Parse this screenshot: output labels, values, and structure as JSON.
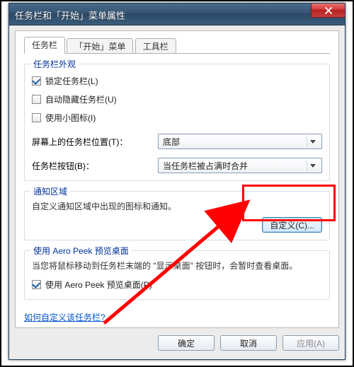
{
  "window": {
    "title": "任务栏和「开始」菜单属性"
  },
  "tabs": {
    "t0": "任务栏",
    "t1": "「开始」菜单",
    "t2": "工具栏"
  },
  "appearance": {
    "legend": "任务栏外观",
    "lock": "锁定任务栏(L)",
    "autohide": "自动隐藏任务栏(U)",
    "smallicons": "使用小图标(I)"
  },
  "position": {
    "label": "屏幕上的任务栏位置(T)：",
    "value": "底部"
  },
  "buttons": {
    "label": "任务栏按钮(B)：",
    "value": "当任务栏被占满时合并"
  },
  "notify": {
    "legend": "通知区域",
    "desc": "自定义通知区域中出现的图标和通知。",
    "customize": "自定义(C)..."
  },
  "aero": {
    "legend": "使用 Aero Peek 预览桌面",
    "desc": "当您将鼠标移动到任务栏末端的 \"显示桌面\" 按钮时，会暂时查看桌面。",
    "checkbox": "使用 Aero Peek 预览桌面(P)"
  },
  "helplink": "如何自定义该任务栏?",
  "footer": {
    "ok": "确定",
    "cancel": "取消",
    "apply": "应用(A)"
  }
}
